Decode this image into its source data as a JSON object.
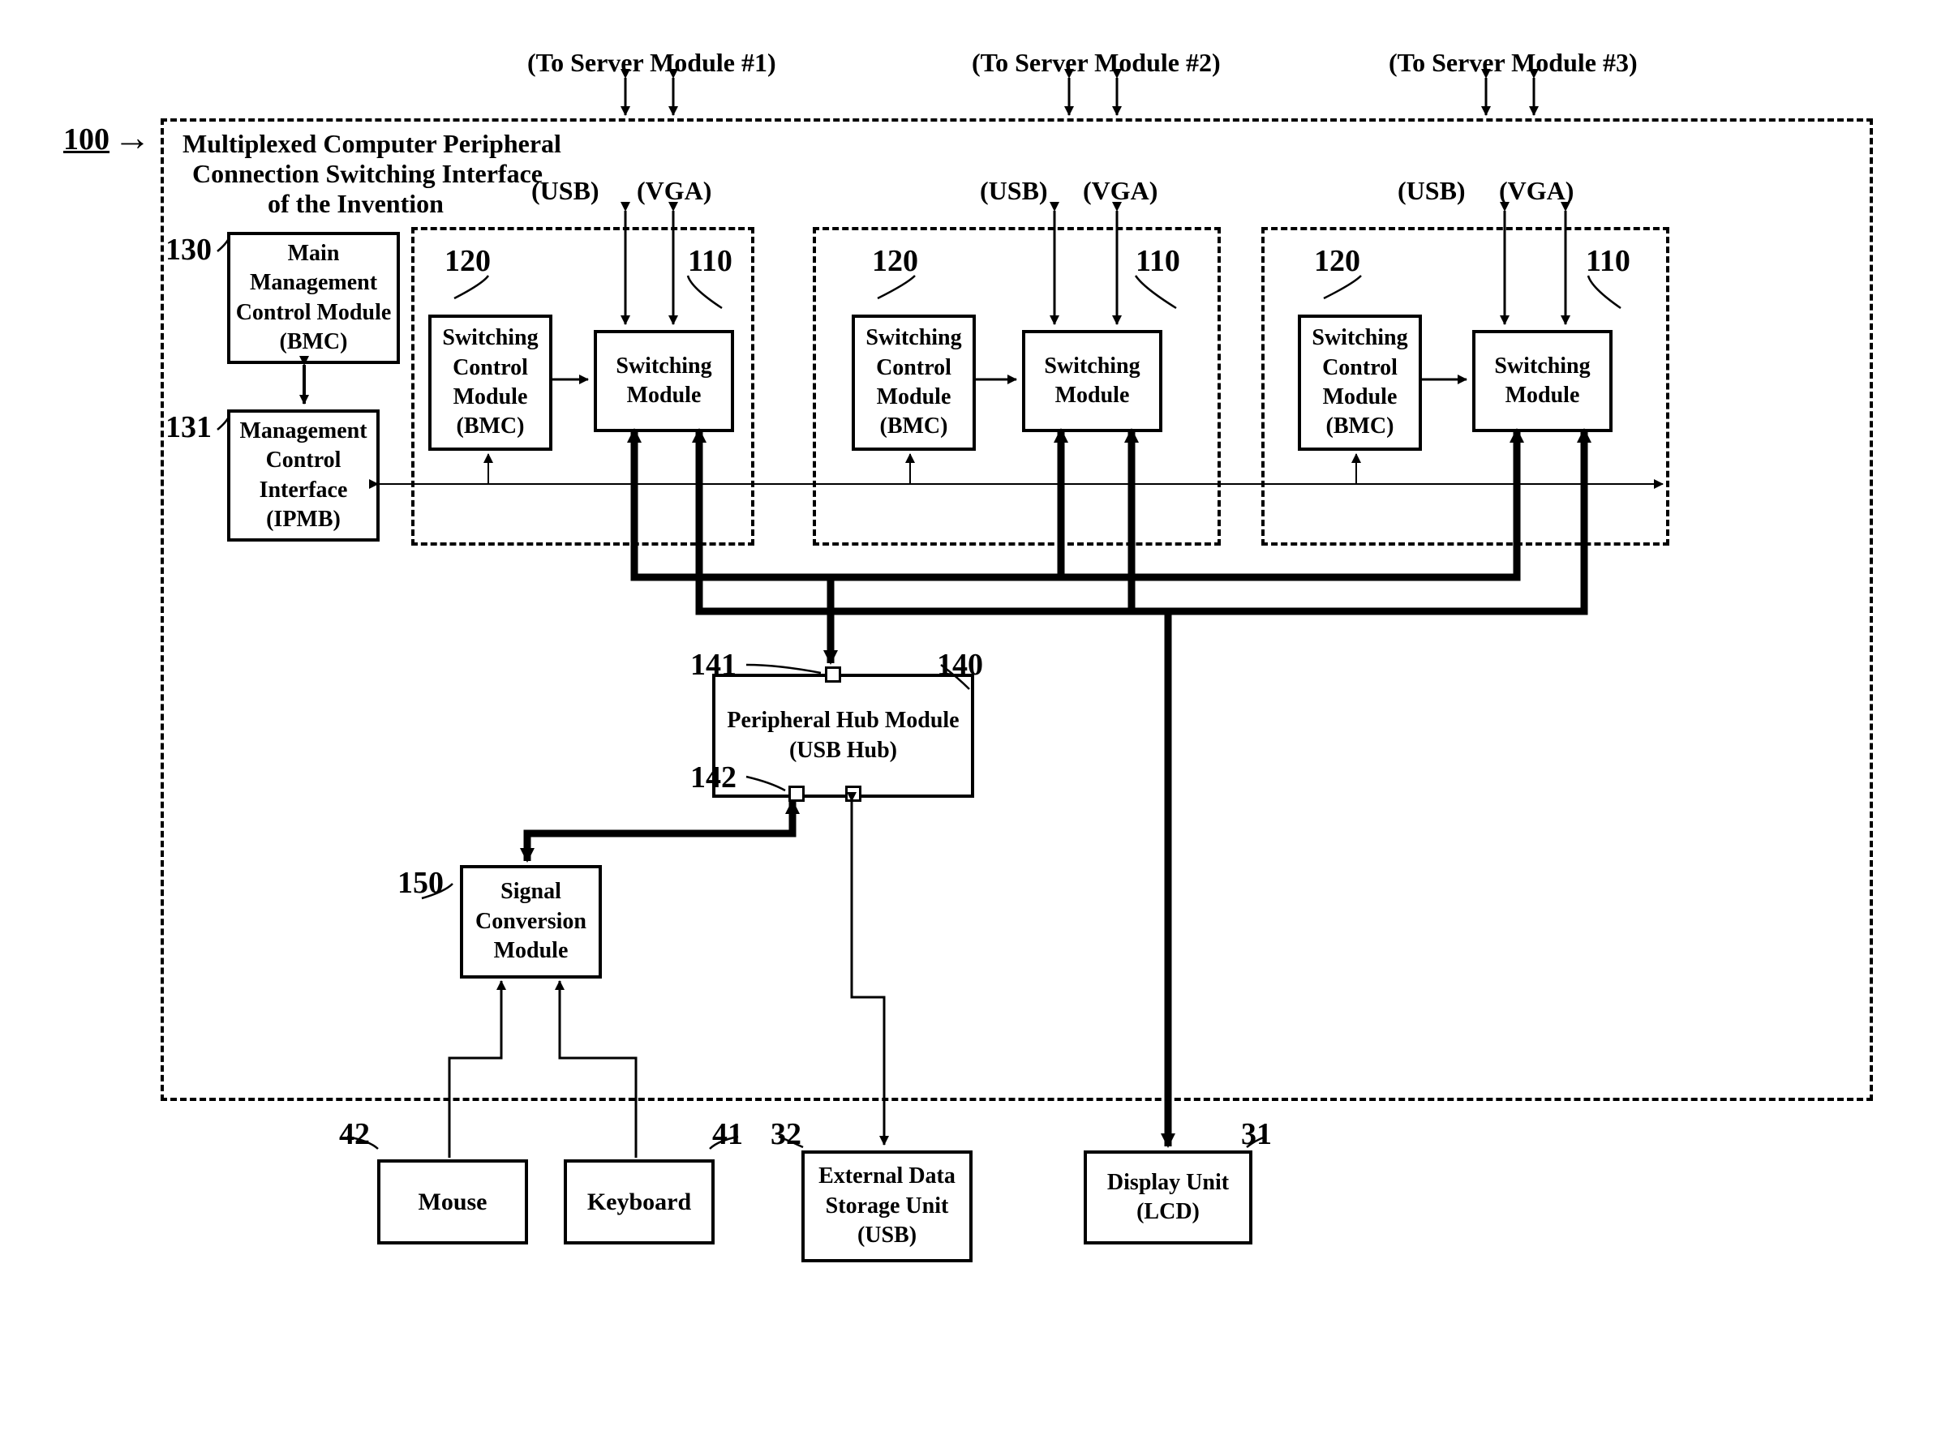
{
  "reference": {
    "num": "100",
    "arrow": "→"
  },
  "title": {
    "l1": "Multiplexed Computer Peripheral",
    "l2": "Connection Switching Interface",
    "l3": "of the Invention"
  },
  "top": {
    "server1": "(To Server Module #1)",
    "server2": "(To Server Module #2)",
    "server3": "(To Server Module #3)",
    "usb": "(USB)",
    "vga": "(VGA)"
  },
  "refs": {
    "r130": "130",
    "r131": "131",
    "r120": "120",
    "r110": "110",
    "r141": "141",
    "r142": "142",
    "r140": "140",
    "r150": "150",
    "r42": "42",
    "r41": "41",
    "r32": "32",
    "r31": "31"
  },
  "blocks": {
    "mmc": {
      "l1": "Main",
      "l2": "Management",
      "l3": "Control Module",
      "l4": "(BMC)"
    },
    "mci": {
      "l1": "Management",
      "l2": "Control",
      "l3": "Interface",
      "l4": "(IPMB)"
    },
    "scm": {
      "l1": "Switching",
      "l2": "Control",
      "l3": "Module",
      "l4": "(BMC)"
    },
    "sm": {
      "l1": "Switching",
      "l2": "Module"
    },
    "phm": {
      "l1": "Peripheral Hub Module",
      "l2": "(USB Hub)"
    },
    "sig": {
      "l1": "Signal",
      "l2": "Conversion",
      "l3": "Module"
    },
    "mouse": "Mouse",
    "keyboard": "Keyboard",
    "ext": {
      "l1": "External Data",
      "l2": "Storage Unit",
      "l3": "(USB)"
    },
    "disp": {
      "l1": "Display Unit",
      "l2": "(LCD)"
    }
  }
}
